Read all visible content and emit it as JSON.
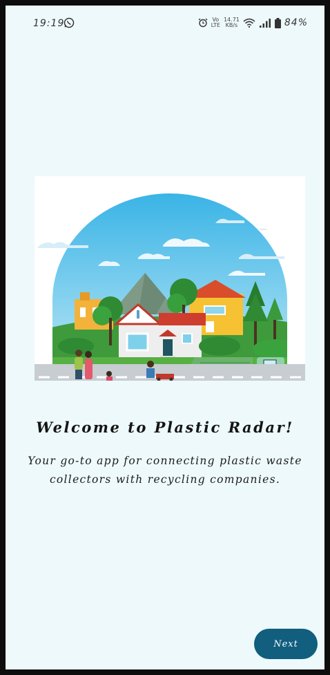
{
  "status_bar": {
    "time": "19:19",
    "network_speed_value": "14.71",
    "network_speed_unit": "KB/s",
    "network_type_top": "Vo",
    "network_type_bottom": "LTE",
    "battery_percent": "84%",
    "icons": [
      "whatsapp-icon",
      "alarm-icon",
      "volte-icon",
      "wifi-icon",
      "signal-icon",
      "battery-icon"
    ]
  },
  "onboarding": {
    "illustration": "houses-illustration",
    "title": "Welcome to Plastic Radar!",
    "subtitle": "Your go-to app for connecting plastic waste collectors with recycling companies.",
    "next_label": "Next"
  },
  "colors": {
    "background": "#eef9fb",
    "accent": "#115e7e",
    "sky": "#4ec3ea"
  }
}
